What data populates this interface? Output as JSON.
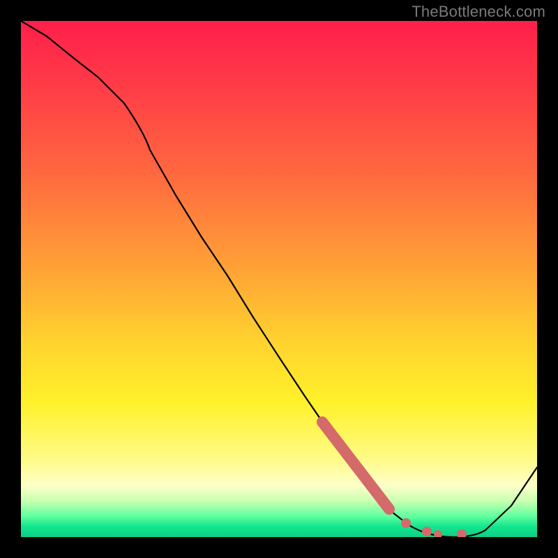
{
  "watermark": "TheBottleneck.com",
  "colors": {
    "marker": "#d46a6a",
    "curve": "#000000",
    "frame": "#000000"
  },
  "chart_data": {
    "type": "line",
    "title": "",
    "xlabel": "",
    "ylabel": "",
    "xlim": [
      0,
      100
    ],
    "ylim": [
      0,
      100
    ],
    "grid": false,
    "legend": false,
    "background": "vertical-gradient-red-to-green",
    "series": [
      {
        "name": "curve",
        "x": [
          0,
          5,
          10,
          15,
          20,
          25,
          30,
          35,
          40,
          45,
          50,
          55,
          60,
          65,
          70,
          75,
          80,
          85,
          90,
          95,
          100
        ],
        "y": [
          100,
          97,
          93,
          89,
          84,
          78,
          70,
          62,
          54,
          45,
          37,
          29,
          21,
          14,
          8,
          3,
          1,
          0,
          1,
          6,
          14
        ]
      }
    ],
    "markers": {
      "thick_segment": {
        "x_start": 59,
        "x_end": 71,
        "note": "highlighted descending segment"
      },
      "dots_x": [
        74,
        78,
        80,
        85
      ]
    },
    "notes": "No axis tick labels or numeric annotations are visible; y-values are estimated from the curve shape relative to plot height."
  }
}
